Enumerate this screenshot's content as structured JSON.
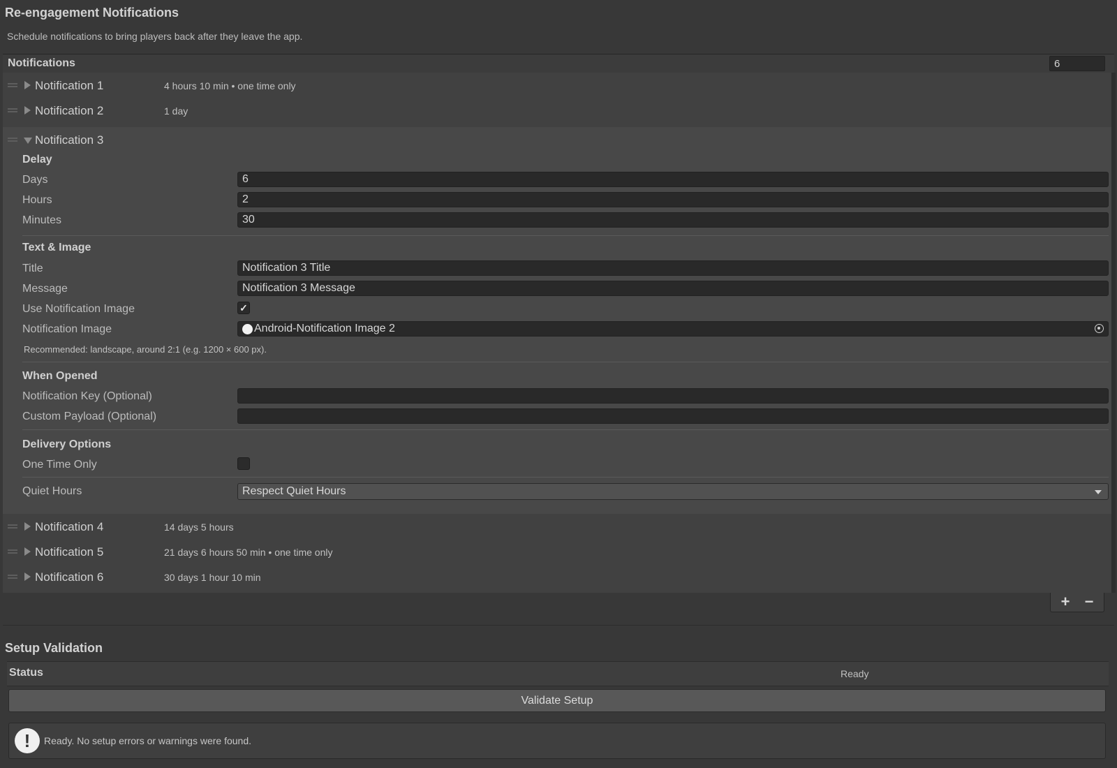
{
  "header": {
    "title": "Re-engagement Notifications",
    "subtitle": "Schedule notifications to bring players back after they leave the app."
  },
  "notifications": {
    "header_label": "Notifications",
    "count": "6",
    "items": [
      {
        "label": "Notification 1",
        "summary": "4 hours 10 min  •  one time only",
        "expanded": false
      },
      {
        "label": "Notification 2",
        "summary": "1 day",
        "expanded": false
      },
      {
        "label": "Notification 3",
        "summary": "",
        "expanded": true
      },
      {
        "label": "Notification 4",
        "summary": "14 days 5 hours",
        "expanded": false
      },
      {
        "label": "Notification 5",
        "summary": "21 days 6 hours 50 min  •  one time only",
        "expanded": false
      },
      {
        "label": "Notification 6",
        "summary": "30 days 1 hour 10 min",
        "expanded": false
      }
    ],
    "add_label": "+",
    "remove_label": "−"
  },
  "detail": {
    "delay": {
      "section": "Delay",
      "days_label": "Days",
      "days_value": "6",
      "hours_label": "Hours",
      "hours_value": "2",
      "minutes_label": "Minutes",
      "minutes_value": "30"
    },
    "text_image": {
      "section": "Text & Image",
      "title_label": "Title",
      "title_value": "Notification 3 Title",
      "message_label": "Message",
      "message_value": "Notification 3 Message",
      "use_image_label": "Use Notification Image",
      "use_image_checked": "✓",
      "image_label": "Notification Image",
      "image_value": "Android-Notification Image 2",
      "hint": "Recommended: landscape, around 2:1 (e.g. 1200 × 600 px)."
    },
    "when_opened": {
      "section": "When Opened",
      "key_label": "Notification Key (Optional)",
      "key_value": "",
      "payload_label": "Custom Payload (Optional)",
      "payload_value": ""
    },
    "delivery": {
      "section": "Delivery Options",
      "one_time_label": "One Time Only",
      "quiet_label": "Quiet Hours",
      "quiet_value": "Respect Quiet Hours"
    }
  },
  "validation": {
    "title": "Setup Validation",
    "status_label": "Status",
    "status_value": "Ready",
    "button": "Validate Setup",
    "message": "Ready. No setup errors or warnings were found.",
    "icon_glyph": "!"
  }
}
